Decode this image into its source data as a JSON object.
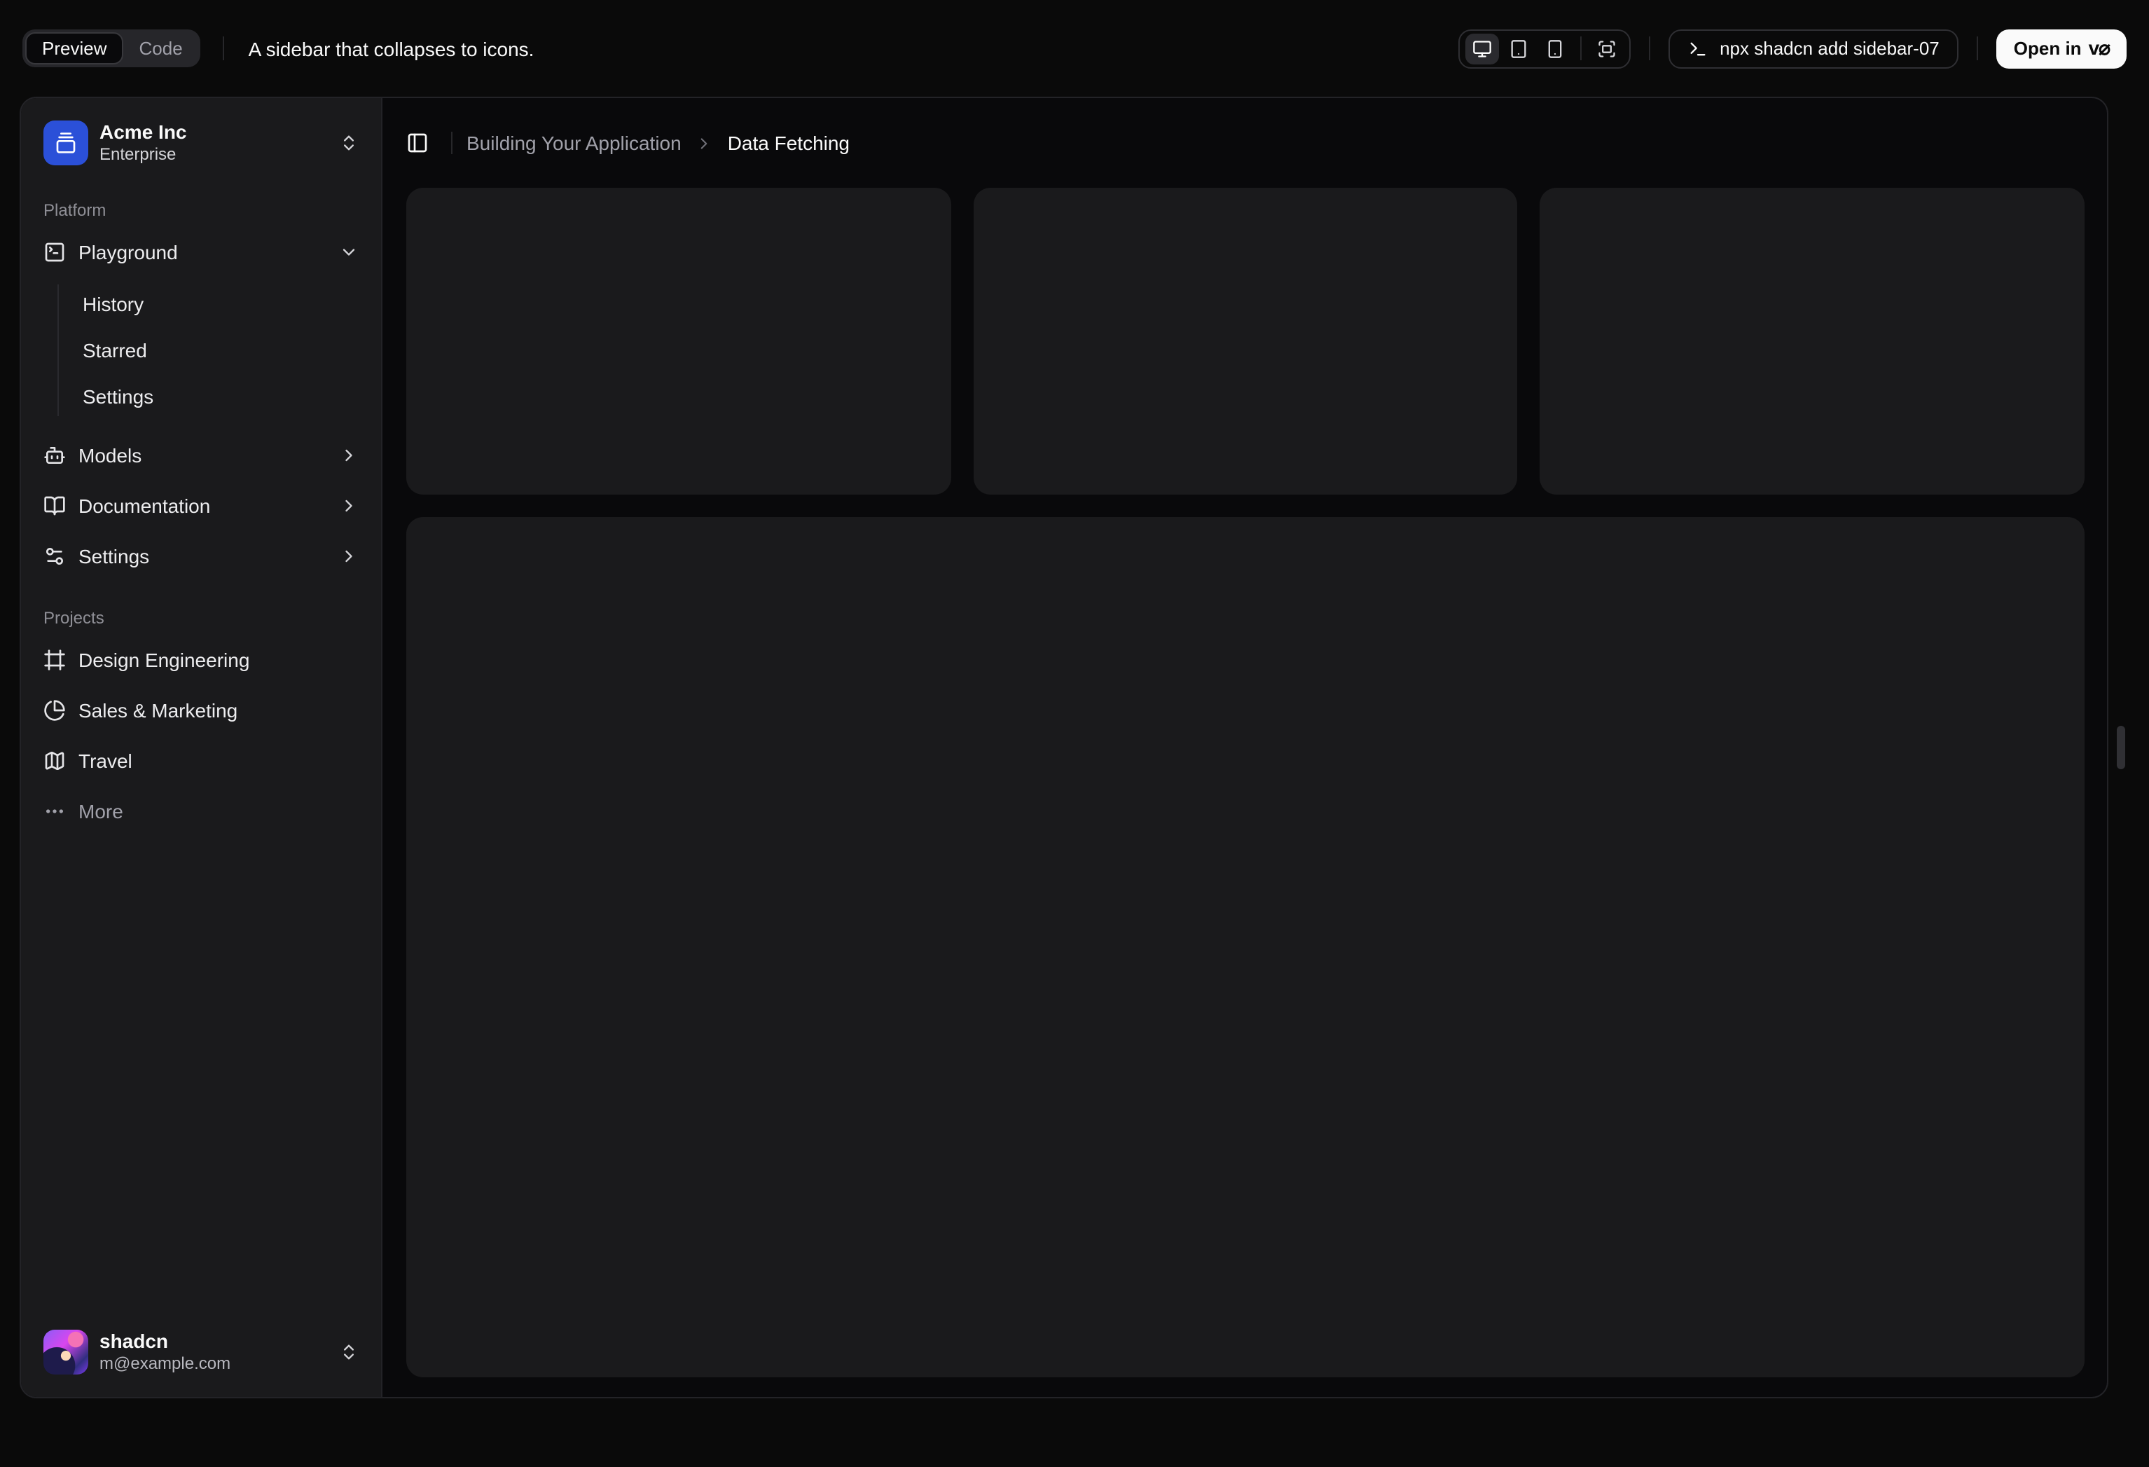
{
  "toolbar": {
    "tabs": {
      "preview": "Preview",
      "code": "Code"
    },
    "description": "A sidebar that collapses to icons.",
    "command": "npx shadcn add sidebar-07",
    "open_in_label": "Open in",
    "v0_logo": "v⌀"
  },
  "sidebar": {
    "team": {
      "name": "Acme Inc",
      "plan": "Enterprise"
    },
    "platform": {
      "label": "Platform",
      "items": [
        {
          "label": "Playground",
          "icon": "square-terminal-icon",
          "expanded": true,
          "children": [
            {
              "label": "History"
            },
            {
              "label": "Starred"
            },
            {
              "label": "Settings"
            }
          ]
        },
        {
          "label": "Models",
          "icon": "bot-icon"
        },
        {
          "label": "Documentation",
          "icon": "book-open-icon"
        },
        {
          "label": "Settings",
          "icon": "settings-sliders-icon"
        }
      ]
    },
    "projects": {
      "label": "Projects",
      "items": [
        {
          "label": "Design Engineering",
          "icon": "frame-icon"
        },
        {
          "label": "Sales & Marketing",
          "icon": "pie-chart-icon"
        },
        {
          "label": "Travel",
          "icon": "map-icon"
        },
        {
          "label": "More",
          "icon": "ellipsis-icon"
        }
      ]
    },
    "user": {
      "name": "shadcn",
      "email": "m@example.com"
    }
  },
  "main": {
    "breadcrumb": {
      "parent": "Building Your Application",
      "current": "Data Fetching"
    }
  },
  "colors": {
    "page_bg": "#0a0a0a",
    "content_bg": "#09090b",
    "sidebar_bg": "#1a1a1c",
    "card_bg": "#1a1a1c",
    "border": "#2f2f33",
    "accent_blue": "#2b50d8",
    "text_primary": "#fafafa",
    "text_muted": "#a1a1aa"
  }
}
